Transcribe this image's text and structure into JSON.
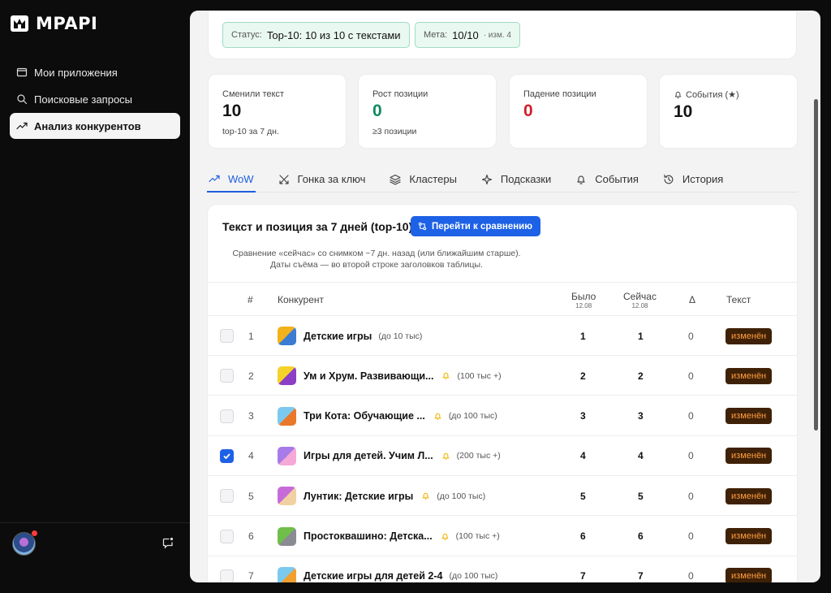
{
  "brand": {
    "name": "MPAPI"
  },
  "sidebar": {
    "items": [
      {
        "label": "Мои приложения",
        "icon": "window-icon",
        "active": false
      },
      {
        "label": "Поисковые запросы",
        "icon": "search-icon",
        "active": false
      },
      {
        "label": "Анализ конкурентов",
        "icon": "trend-icon",
        "active": true
      }
    ]
  },
  "status": {
    "status_label": "Статус:",
    "status_value": "Top-10: 10 из 10 с текстами",
    "meta_label": "Мета:",
    "meta_value": "10/10",
    "meta_sub": "· изм. 4"
  },
  "stats": [
    {
      "label": "Сменили текст",
      "value": "10",
      "sub": "top-10 за 7 дн.",
      "color": "#141414"
    },
    {
      "label": "Рост позиции",
      "value": "0",
      "sub": "≥3 позиции",
      "color": "#0f8a5f"
    },
    {
      "label": "Падение позиции",
      "value": "0",
      "sub": "",
      "color": "#d0202a"
    },
    {
      "label": "События (★)",
      "value": "10",
      "sub": "",
      "color": "#141414"
    }
  ],
  "tabs": [
    {
      "label": "WoW",
      "icon": "trend-icon",
      "active": true
    },
    {
      "label": "Гонка за ключ",
      "icon": "swords-icon",
      "active": false
    },
    {
      "label": "Кластеры",
      "icon": "layers-icon",
      "active": false
    },
    {
      "label": "Подсказки",
      "icon": "sparkle-icon",
      "active": false
    },
    {
      "label": "События",
      "icon": "bell-icon",
      "active": false
    },
    {
      "label": "История",
      "icon": "history-icon",
      "active": false
    }
  ],
  "table": {
    "title": "Текст и позиция за 7 дней (top-10)",
    "compare_button": "Перейти к сравнению",
    "desc_line1": "Сравнение «сейчас» со снимком ~7 дн. назад (или ближайшим старше).",
    "desc_line2": "Даты съёма — во второй строке заголовков таблицы.",
    "headers": {
      "num": "#",
      "competitor": "Конкурент",
      "was": "Было",
      "was_date": "12.08",
      "now": "Сейчас",
      "now_date": "12.08",
      "delta": "Δ",
      "text": "Текст"
    },
    "rows": [
      {
        "n": "1",
        "name": "Детские игры",
        "bell": false,
        "installs": "(до 10 тыс)",
        "was": "1",
        "now": "1",
        "delta": "0",
        "status": "изменён",
        "checked": false,
        "icon_colors": [
          "#f2b21b",
          "#3b7bd4"
        ]
      },
      {
        "n": "2",
        "name": "Ум и Хрум. Развивающи...",
        "bell": true,
        "installs": "(100 тыс +)",
        "was": "2",
        "now": "2",
        "delta": "0",
        "status": "изменён",
        "checked": false,
        "icon_colors": [
          "#f4d22a",
          "#8a3fc4"
        ]
      },
      {
        "n": "3",
        "name": "Три Кота: Обучающие ...",
        "bell": true,
        "installs": "(до 100 тыс)",
        "was": "3",
        "now": "3",
        "delta": "0",
        "status": "изменён",
        "checked": false,
        "icon_colors": [
          "#7cc9ef",
          "#e9782a"
        ]
      },
      {
        "n": "4",
        "name": "Игры для детей. Учим Л...",
        "bell": true,
        "installs": "(200 тыс +)",
        "was": "4",
        "now": "4",
        "delta": "0",
        "status": "изменён",
        "checked": true,
        "icon_colors": [
          "#a77be8",
          "#f4a9d6"
        ]
      },
      {
        "n": "5",
        "name": "Лунтик: Детские игры",
        "bell": true,
        "installs": "(до 100 тыс)",
        "was": "5",
        "now": "5",
        "delta": "0",
        "status": "изменён",
        "checked": false,
        "icon_colors": [
          "#c76bd9",
          "#f1d1a2"
        ]
      },
      {
        "n": "6",
        "name": "Простоквашино: Детска...",
        "bell": true,
        "installs": "(100 тыс +)",
        "was": "6",
        "now": "6",
        "delta": "0",
        "status": "изменён",
        "checked": false,
        "icon_colors": [
          "#6fbf4a",
          "#8b8b93"
        ]
      },
      {
        "n": "7",
        "name": "Детские игры для детей 2-4",
        "bell": false,
        "installs": "(до 100 тыс)",
        "was": "7",
        "now": "7",
        "delta": "0",
        "status": "изменён",
        "checked": false,
        "icon_colors": [
          "#7cc9ef",
          "#f0a030"
        ]
      }
    ]
  }
}
